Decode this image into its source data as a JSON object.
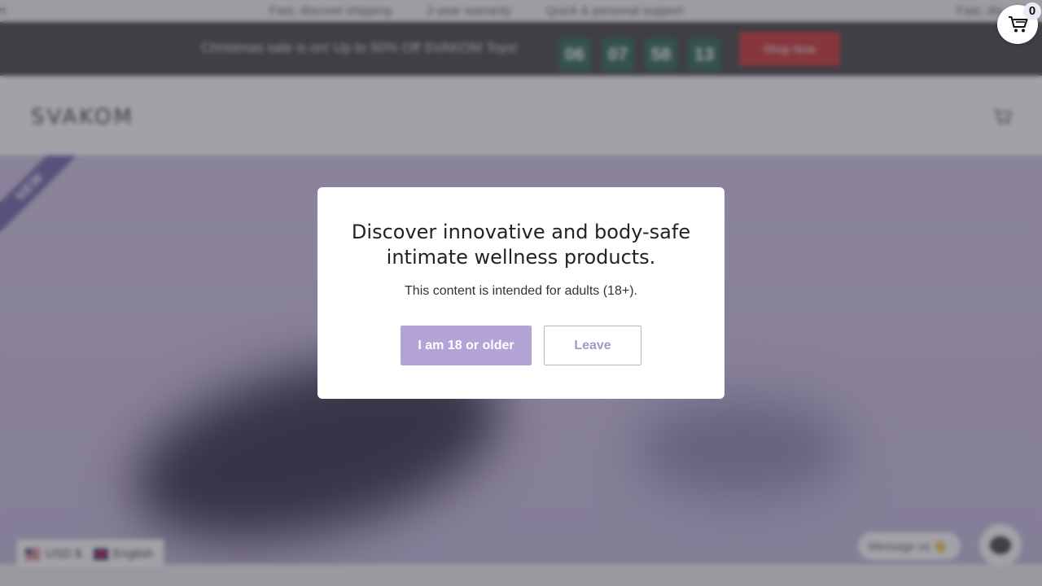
{
  "announcement": {
    "items": [
      "rt",
      "Fast, discreet shipping",
      "2-year warranty",
      "Quick & personal support",
      "Fast, dis"
    ]
  },
  "promo": {
    "message": "Christmas sale is on! Up to 50% Off SVAKOM Toys!",
    "countdown": [
      "06",
      "07",
      "58",
      "13"
    ],
    "shop_label": "Shop Now",
    "countdown_color": "#22604a",
    "button_color": "#c62a2a"
  },
  "header": {
    "logo_text": "SVAKOM",
    "cart_icon": "cart-icon"
  },
  "hero": {
    "ribbon_label": "NEW"
  },
  "cart": {
    "count": "0",
    "icon": "cart-icon"
  },
  "age_gate": {
    "heading": "Discover innovative and body-safe intimate wellness products.",
    "note": "This content is intended for adults (18+).",
    "confirm_label": "I am 18 or older",
    "leave_label": "Leave",
    "accent_color": "#b3a3d6"
  },
  "locale": {
    "currency": "USD $",
    "language": "English"
  },
  "chat": {
    "label": "Message us 👋",
    "icon": "chat-icon"
  }
}
